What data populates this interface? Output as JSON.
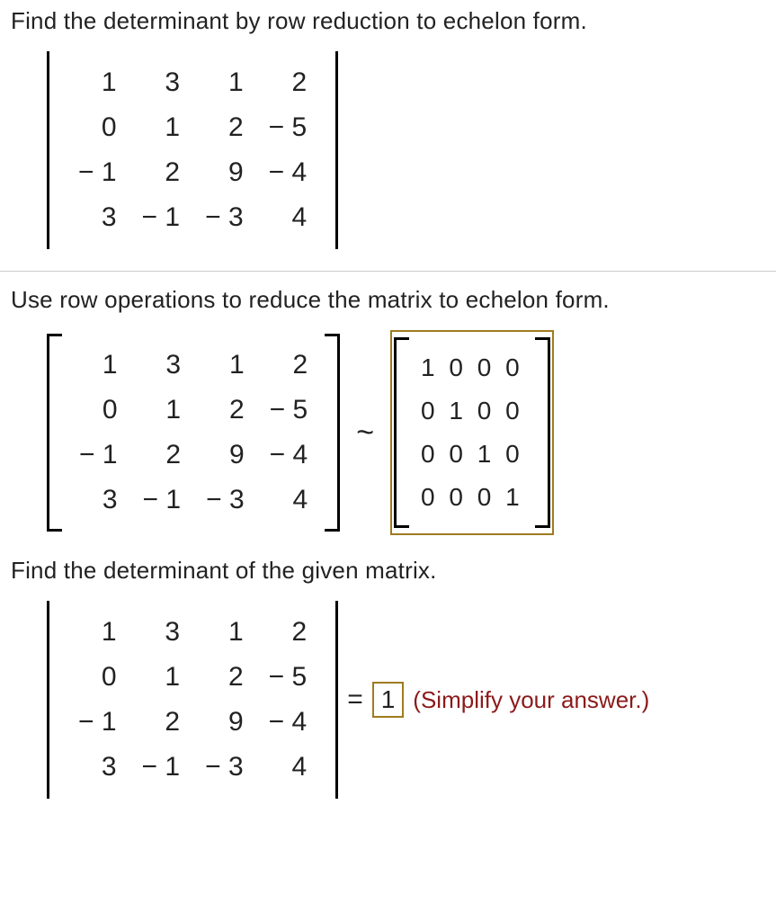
{
  "prompt1": "Find the determinant by row reduction to echelon form.",
  "prompt2": "Use row operations to reduce the matrix to echelon form.",
  "prompt3": "Find the determinant of the given matrix.",
  "matrixA": {
    "r0": {
      "c0": "1",
      "c1": "3",
      "c2": "1",
      "c3": "2"
    },
    "r1": {
      "c0": "0",
      "c1": "1",
      "c2": "2",
      "c3": "− 5"
    },
    "r2": {
      "c0": "− 1",
      "c1": "2",
      "c2": "9",
      "c3": "− 4"
    },
    "r3": {
      "c0": "3",
      "c1": "− 1",
      "c2": "− 3",
      "c3": "4"
    }
  },
  "tilde": "~",
  "echelon": {
    "r0": "1 0 0 0",
    "r1": "0 1 0 0",
    "r2": "0 0 1 0",
    "r3": "0 0 0 1"
  },
  "equals": "=",
  "det_answer": "1",
  "hint": "(Simplify your answer.)"
}
